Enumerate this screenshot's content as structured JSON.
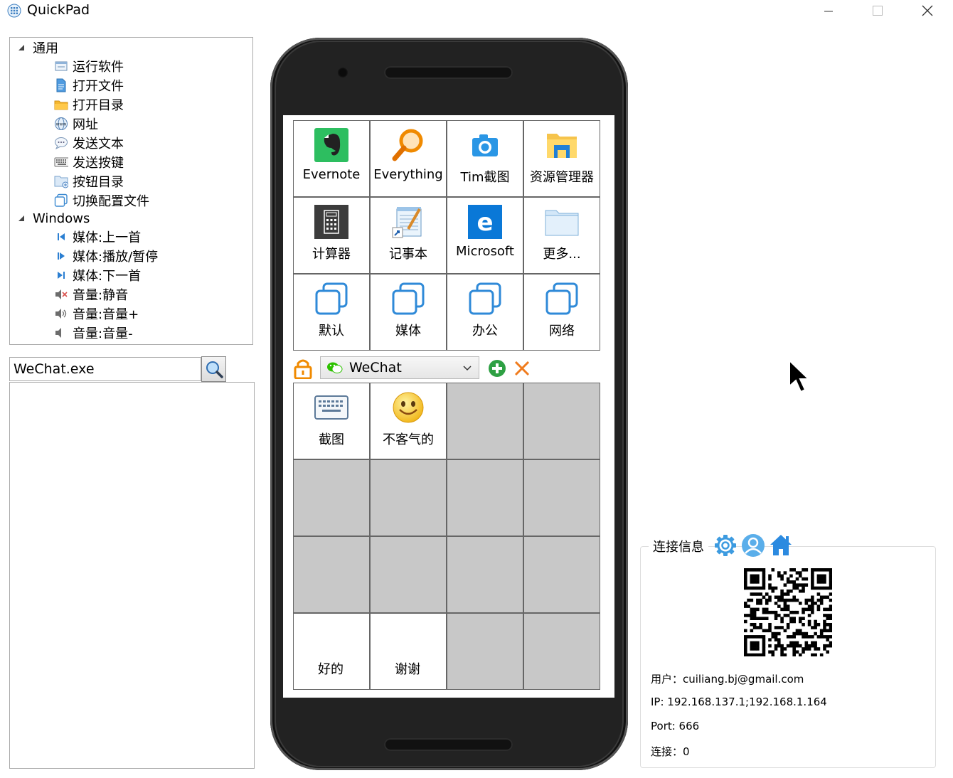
{
  "window": {
    "title": "QuickPad"
  },
  "tree": {
    "groups": [
      {
        "label": "通用",
        "items": [
          {
            "label": "运行软件",
            "icon": "run-software-icon"
          },
          {
            "label": "打开文件",
            "icon": "open-file-icon"
          },
          {
            "label": "打开目录",
            "icon": "open-folder-icon"
          },
          {
            "label": "网址",
            "icon": "globe-www-icon"
          },
          {
            "label": "发送文本",
            "icon": "send-text-icon"
          },
          {
            "label": "发送按键",
            "icon": "keyboard-icon"
          },
          {
            "label": "按钮目录",
            "icon": "button-folder-icon"
          },
          {
            "label": "切换配置文件",
            "icon": "switch-profile-icon"
          }
        ]
      },
      {
        "label": "Windows",
        "items": [
          {
            "label": "媒体:上一首",
            "icon": "media-previous-icon"
          },
          {
            "label": "媒体:播放/暂停",
            "icon": "media-play-pause-icon"
          },
          {
            "label": "媒体:下一首",
            "icon": "media-next-icon"
          },
          {
            "label": "音量:静音",
            "icon": "volume-mute-icon"
          },
          {
            "label": "音量:音量+",
            "icon": "volume-up-icon"
          },
          {
            "label": "音量:音量-",
            "icon": "volume-down-icon"
          }
        ]
      }
    ]
  },
  "search": {
    "value": "WeChat.exe"
  },
  "phone": {
    "global_buttons": [
      {
        "label": "Evernote",
        "icon": "evernote-icon"
      },
      {
        "label": "Everything",
        "icon": "everything-search-icon"
      },
      {
        "label": "Tim截图",
        "icon": "camera-icon"
      },
      {
        "label": "资源管理器",
        "icon": "file-explorer-icon"
      },
      {
        "label": "计算器",
        "icon": "calculator-icon"
      },
      {
        "label": "记事本",
        "icon": "notepad-icon"
      },
      {
        "label": "Microsoft",
        "icon": "edge-icon"
      },
      {
        "label": "更多...",
        "icon": "folder-icon"
      },
      {
        "label": "默认",
        "icon": "profile-copy-icon"
      },
      {
        "label": "媒体",
        "icon": "profile-copy-icon"
      },
      {
        "label": "办公",
        "icon": "profile-copy-icon"
      },
      {
        "label": "网络",
        "icon": "profile-copy-icon"
      }
    ],
    "app_select": {
      "value": "WeChat"
    },
    "app_buttons": [
      {
        "label": "截图",
        "icon": "keyboard-icon"
      },
      {
        "label": "不客气的",
        "icon": "smiley-icon"
      },
      {
        "label": "",
        "icon": ""
      },
      {
        "label": "",
        "icon": ""
      },
      {
        "label": "",
        "icon": ""
      },
      {
        "label": "",
        "icon": ""
      },
      {
        "label": "",
        "icon": ""
      },
      {
        "label": "",
        "icon": ""
      },
      {
        "label": "",
        "icon": ""
      },
      {
        "label": "",
        "icon": ""
      },
      {
        "label": "",
        "icon": ""
      },
      {
        "label": "",
        "icon": ""
      },
      {
        "label": "好的",
        "icon": ""
      },
      {
        "label": "谢谢",
        "icon": ""
      },
      {
        "label": "",
        "icon": ""
      },
      {
        "label": "",
        "icon": ""
      }
    ]
  },
  "connection": {
    "title": "连接信息",
    "user": "用户：cuiliang.bj@gmail.com",
    "ip": "IP: 192.168.137.1;192.168.1.164",
    "port": "Port: 666",
    "connections": "连接：0"
  },
  "colors": {
    "accent_blue": "#3d9be0",
    "empty_cell": "#c8c8c8",
    "phone_body": "#222222",
    "add_green": "#2ea043",
    "delete_orange": "#f07c1e"
  }
}
